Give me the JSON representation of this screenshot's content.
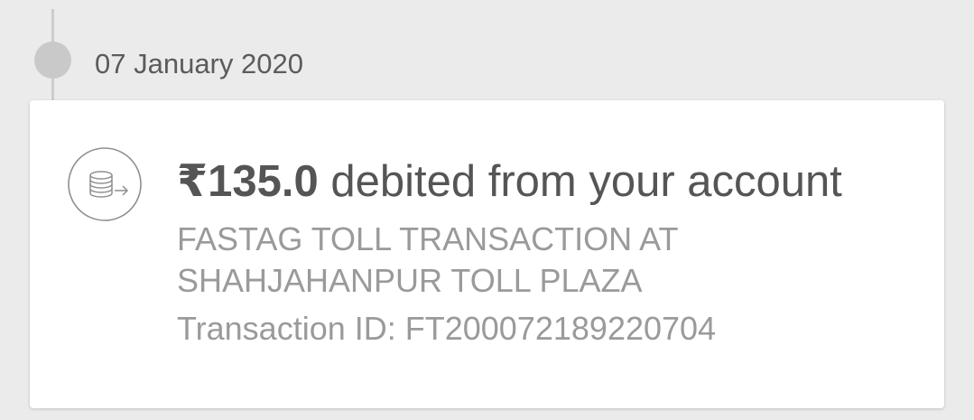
{
  "timeline": {
    "date": "07 January 2020"
  },
  "transaction": {
    "icon": "coins-transfer-icon",
    "amount": "₹135.0",
    "amount_suffix": " debited from your account",
    "description": "FASTAG TOLL TRANSACTION AT SHAHJAHANPUR TOLL PLAZA",
    "id_label": "Transaction ID: ",
    "id_value": "FT200072189220704"
  }
}
